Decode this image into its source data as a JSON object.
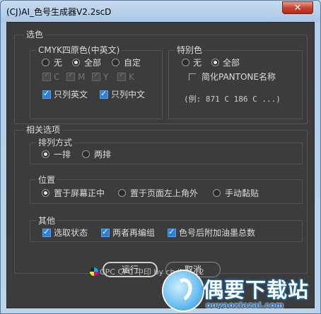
{
  "window": {
    "title": "(CJ)AI_色号生成器V2.2scD",
    "close_glyph": "✕"
  },
  "color_select": {
    "group_label": "选色",
    "cmyk": {
      "group_label": "CMYK四原色(中英文)",
      "options": [
        "无",
        "全部",
        "自定"
      ],
      "channels": [
        "C",
        "M",
        "Y",
        "K"
      ],
      "only_english": "只列英文",
      "only_chinese": "只列中文"
    },
    "spot": {
      "group_label": "特别色",
      "options": [
        "无",
        "全部"
      ],
      "simplify_pantone": "简化PANTONE名称",
      "example": "(例: 871 C 186 C ...)"
    }
  },
  "options": {
    "group_label": "相关选项",
    "arrange": {
      "group_label": "排列方式",
      "options": [
        "一排",
        "两排"
      ]
    },
    "position": {
      "group_label": "位置",
      "options": [
        "置于屏幕正中",
        "置于页面左上角外",
        "手动黏贴"
      ]
    },
    "other": {
      "group_label": "其他",
      "checks": [
        "选取状态",
        "两者再编组",
        "色号后附加油墨总数"
      ]
    }
  },
  "buttons": {
    "run": "运行",
    "cancel": "取消"
  },
  "footer": {
    "text": "CPC CPC 中印 by ch ih Y 12"
  },
  "watermark": {
    "title": "偶要下载站",
    "url": "ouyaoxiazai.com"
  },
  "colors": {
    "panel": "#3c3c3c",
    "accent": "#2d7fd8",
    "titlebar": "#b9d1ea",
    "close": "#c8412f"
  }
}
